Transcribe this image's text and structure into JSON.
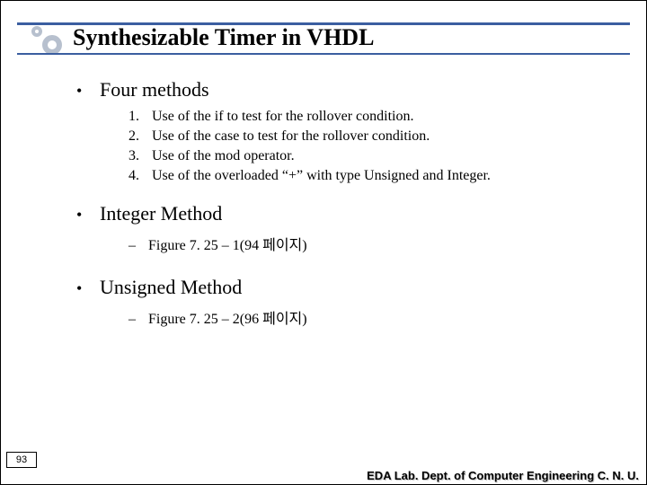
{
  "title": "Synthesizable Timer in VHDL",
  "sections": {
    "s1": {
      "heading": "Four methods",
      "items": [
        "Use of the if to test for the rollover condition.",
        "Use of the case to test for the rollover condition.",
        "Use of the mod operator.",
        "Use of the overloaded “+” with type Unsigned and Integer."
      ]
    },
    "s2": {
      "heading": "Integer Method",
      "sub": "Figure 7. 25 – 1(94 페이지)"
    },
    "s3": {
      "heading": "Unsigned Method",
      "sub": "Figure 7. 25 – 2(96 페이지)"
    }
  },
  "page_number": "93",
  "footer": "EDA Lab. Dept. of Computer Engineering C. N. U."
}
